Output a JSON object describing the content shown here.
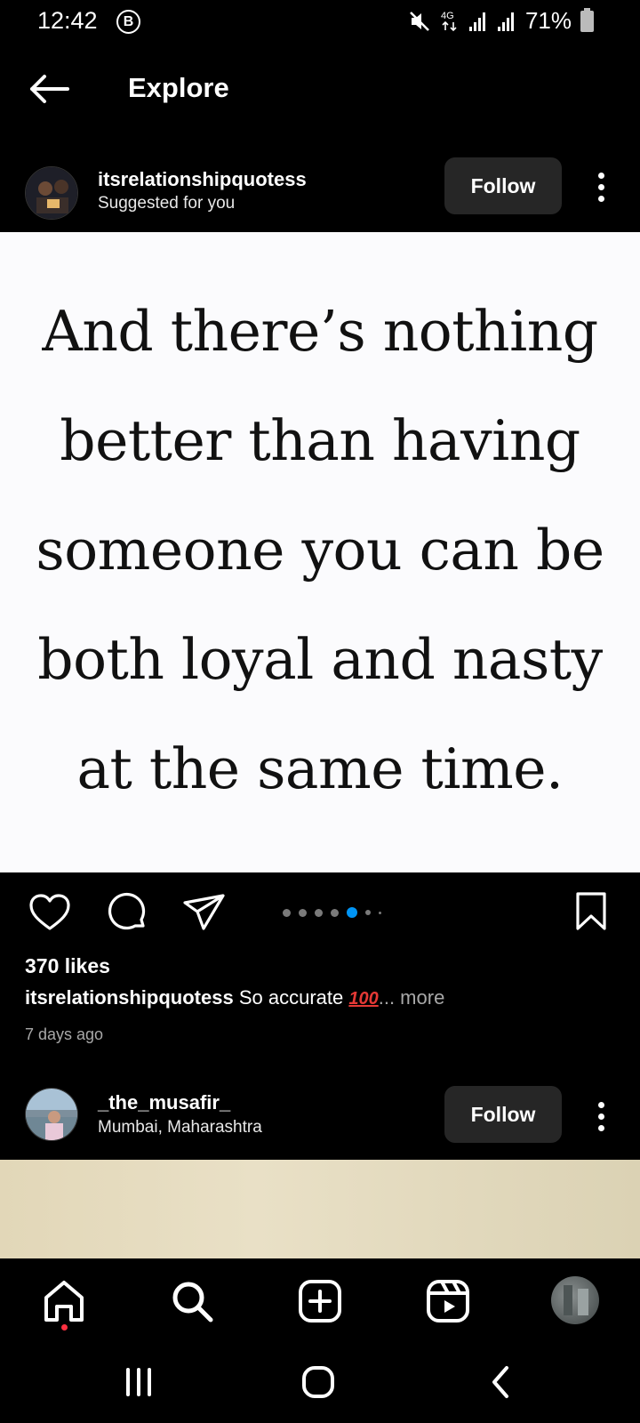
{
  "status_bar": {
    "time": "12:42",
    "b_icon": "B",
    "network": "4G",
    "battery": "71%"
  },
  "header": {
    "title": "Explore"
  },
  "post1": {
    "username": "itsrelationshipquotess",
    "subtitle": "Suggested for you",
    "follow_label": "Follow",
    "quote_lines": [
      "And there’s nothing",
      "better than having",
      "someone you can be",
      "both loyal and nasty",
      "at the same time."
    ],
    "carousel": {
      "count": 7,
      "active_index": 4
    },
    "likes": "370 likes",
    "caption_user": "itsrelationshipquotess",
    "caption_text": " So accurate ",
    "caption_emoji": "100",
    "caption_more": "... more",
    "time_ago": "7 days ago"
  },
  "post2": {
    "username": "_the_musafir_",
    "location": "Mumbai, Maharashtra",
    "follow_label": "Follow"
  },
  "bottom_nav": {
    "items": [
      "home-icon",
      "search-icon",
      "create-icon",
      "reels-icon",
      "profile-avatar"
    ],
    "has_notification_dot": true
  },
  "colors": {
    "background": "#000000",
    "button_bg": "#262626",
    "accent_blue": "#0095f6",
    "notification_red": "#ff3040"
  }
}
